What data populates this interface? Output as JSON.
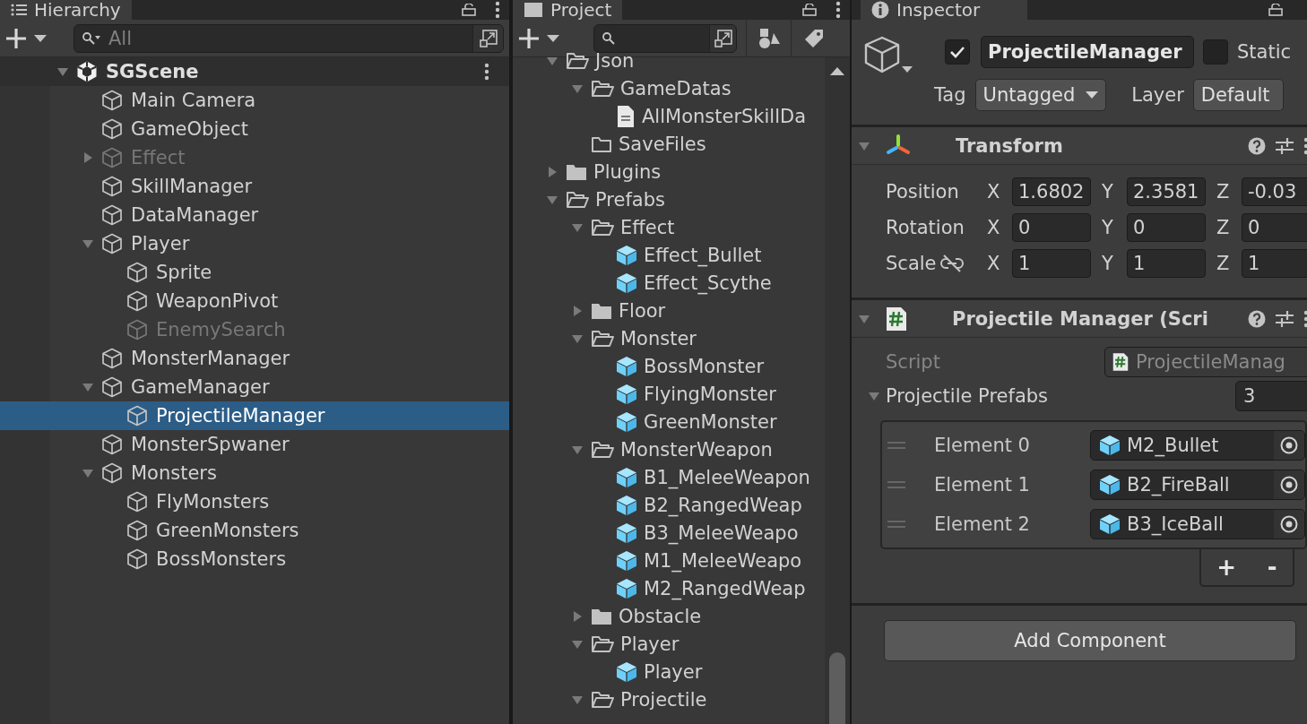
{
  "hierarchy": {
    "tab": "Hierarchy",
    "search_placeholder": "All",
    "scene": {
      "name": "SGScene",
      "expanded": true,
      "children": [
        {
          "name": "Main Camera",
          "selected": false,
          "disabled": false
        },
        {
          "name": "GameObject",
          "selected": false,
          "disabled": false
        },
        {
          "name": "Effect",
          "expanded": false,
          "selected": false,
          "disabled": true
        },
        {
          "name": "SkillManager",
          "selected": false,
          "disabled": false
        },
        {
          "name": "DataManager",
          "selected": false,
          "disabled": false
        },
        {
          "name": "Player",
          "expanded": true,
          "selected": false,
          "disabled": false,
          "children": [
            {
              "name": "Sprite",
              "selected": false,
              "disabled": false
            },
            {
              "name": "WeaponPivot",
              "selected": false,
              "disabled": false
            },
            {
              "name": "EnemySearch",
              "selected": false,
              "disabled": true
            }
          ]
        },
        {
          "name": "MonsterManager",
          "selected": false,
          "disabled": false
        },
        {
          "name": "GameManager",
          "expanded": true,
          "selected": false,
          "disabled": false,
          "children": [
            {
              "name": "ProjectileManager",
              "selected": true,
              "disabled": false
            }
          ]
        },
        {
          "name": "MonsterSpwaner",
          "selected": false,
          "disabled": false
        },
        {
          "name": "Monsters",
          "expanded": true,
          "selected": false,
          "disabled": false,
          "children": [
            {
              "name": "FlyMonsters",
              "selected": false,
              "disabled": false
            },
            {
              "name": "GreenMonsters",
              "selected": false,
              "disabled": false
            },
            {
              "name": "BossMonsters",
              "selected": false,
              "disabled": false
            }
          ]
        }
      ]
    }
  },
  "project": {
    "tab": "Project",
    "items": [
      {
        "name": "Json",
        "kind": "folder",
        "expanded": true,
        "children": [
          {
            "name": "GameDatas",
            "kind": "folder",
            "expanded": true,
            "children": [
              {
                "name": "AllMonsterSkillDa",
                "kind": "file"
              }
            ]
          },
          {
            "name": "SaveFiles",
            "kind": "empty_folder"
          }
        ]
      },
      {
        "name": "Plugins",
        "kind": "folder",
        "expanded": false
      },
      {
        "name": "Prefabs",
        "kind": "folder",
        "expanded": true,
        "children": [
          {
            "name": "Effect",
            "kind": "folder",
            "expanded": true,
            "children": [
              {
                "name": "Effect_Bullet",
                "kind": "prefab"
              },
              {
                "name": "Effect_Scythe",
                "kind": "prefab"
              }
            ]
          },
          {
            "name": "Floor",
            "kind": "folder",
            "expanded": false
          },
          {
            "name": "Monster",
            "kind": "folder",
            "expanded": true,
            "children": [
              {
                "name": "BossMonster",
                "kind": "prefab"
              },
              {
                "name": "FlyingMonster",
                "kind": "prefab"
              },
              {
                "name": "GreenMonster",
                "kind": "prefab"
              }
            ]
          },
          {
            "name": "MonsterWeapon",
            "kind": "folder",
            "expanded": true,
            "children": [
              {
                "name": "B1_MeleeWeapon",
                "kind": "prefab"
              },
              {
                "name": "B2_RangedWeap",
                "kind": "prefab"
              },
              {
                "name": "B3_MeleeWeapo",
                "kind": "prefab"
              },
              {
                "name": "M1_MeleeWeapo",
                "kind": "prefab"
              },
              {
                "name": "M2_RangedWeap",
                "kind": "prefab"
              }
            ]
          },
          {
            "name": "Obstacle",
            "kind": "folder",
            "expanded": false
          },
          {
            "name": "Player",
            "kind": "folder",
            "expanded": true,
            "children": [
              {
                "name": "Player",
                "kind": "prefab"
              }
            ]
          },
          {
            "name": "Projectile",
            "kind": "folder",
            "expanded": true
          }
        ]
      }
    ]
  },
  "inspector": {
    "tab": "Inspector",
    "object": {
      "active": true,
      "name": "ProjectileManager",
      "static": false,
      "static_label": "Static",
      "tag_label": "Tag",
      "tag": "Untagged",
      "layer_label": "Layer",
      "layer": "Default"
    },
    "components": [
      {
        "kind": "transform",
        "title": "Transform",
        "expanded": true,
        "rows": [
          {
            "label": "Position",
            "fields": [
              {
                "axis": "X",
                "value": "1.6802"
              },
              {
                "axis": "Y",
                "value": "2.3581"
              },
              {
                "axis": "Z",
                "value": "-0.03"
              }
            ]
          },
          {
            "label": "Rotation",
            "fields": [
              {
                "axis": "X",
                "value": "0"
              },
              {
                "axis": "Y",
                "value": "0"
              },
              {
                "axis": "Z",
                "value": "0"
              }
            ]
          },
          {
            "label": "Scale",
            "fields": [
              {
                "axis": "X",
                "value": "1"
              },
              {
                "axis": "Y",
                "value": "1"
              },
              {
                "axis": "Z",
                "value": "1"
              }
            ]
          }
        ]
      },
      {
        "kind": "script",
        "title": "Projectile Manager (Scri",
        "expanded": true,
        "script_label": "Script",
        "script_value": "ProjectileManag",
        "array": {
          "label": "Projectile Prefabs",
          "expanded": true,
          "size": "3",
          "add": "+",
          "remove": "-",
          "elements": [
            {
              "label": "Element 0",
              "value": "M2_Bullet"
            },
            {
              "label": "Element 1",
              "value": "B2_FireBall"
            },
            {
              "label": "Element 2",
              "value": "B3_IceBall"
            }
          ]
        }
      }
    ],
    "add_component": "Add Component"
  }
}
